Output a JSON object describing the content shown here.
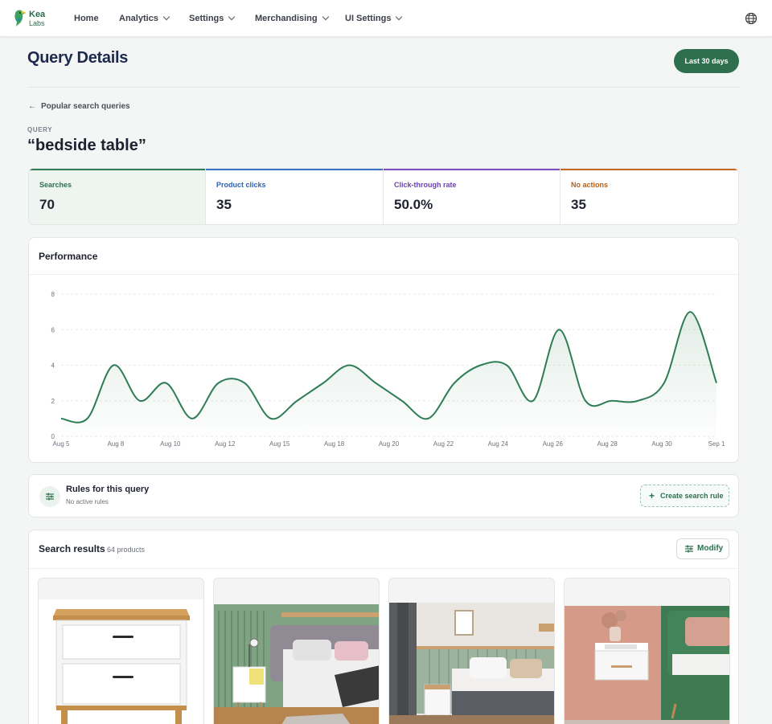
{
  "nav": {
    "brand_line1": "Kea",
    "brand_line2": "Labs",
    "items": [
      {
        "label": "Home",
        "has_menu": false
      },
      {
        "label": "Analytics",
        "has_menu": true
      },
      {
        "label": "Settings",
        "has_menu": true
      },
      {
        "label": "Merchandising",
        "has_menu": true
      },
      {
        "label": "UI Settings",
        "has_menu": true
      }
    ],
    "language_icon": "globe-icon"
  },
  "header": {
    "title": "Query Details",
    "date_range_label": "Last 30 days",
    "back_label": "Popular search queries"
  },
  "query": {
    "label": "QUERY",
    "text": "“bedside table”"
  },
  "stats": [
    {
      "label": "Searches",
      "value": "70",
      "color": "#2e7d55",
      "active": true
    },
    {
      "label": "Product clicks",
      "value": "35",
      "color": "#3a73c4",
      "active": false
    },
    {
      "label": "Click-through rate",
      "value": "50.0%",
      "color": "#7a4fc0",
      "active": false
    },
    {
      "label": "No actions",
      "value": "35",
      "color": "#c56a1d",
      "active": false
    }
  ],
  "performance": {
    "title": "Performance"
  },
  "chart_data": {
    "type": "area",
    "title": "Performance",
    "xlabel": "",
    "ylabel": "",
    "ylim": [
      0,
      8
    ],
    "yticks": [
      0,
      2,
      4,
      6,
      8
    ],
    "grid": true,
    "color": "#2e7d55",
    "x": [
      "Aug 5",
      "Aug 6",
      "Aug 7",
      "Aug 8",
      "Aug 9",
      "Aug 10",
      "Aug 11",
      "Aug 12",
      "Aug 13",
      "Aug 14",
      "Aug 15",
      "Aug 16",
      "Aug 17",
      "Aug 18",
      "Aug 19",
      "Aug 20",
      "Aug 21",
      "Aug 22",
      "Aug 23",
      "Aug 24",
      "Aug 25",
      "Aug 26",
      "Aug 27",
      "Aug 28",
      "Aug 29",
      "Aug 30",
      "Aug 31",
      "Sep 1"
    ],
    "x_tick_labels": [
      "Aug 5",
      "Aug 8",
      "Aug 10",
      "Aug 12",
      "Aug 15",
      "Aug 18",
      "Aug 20",
      "Aug 22",
      "Aug 24",
      "Aug 26",
      "Aug 28",
      "Aug 30",
      "Sep 1"
    ],
    "series": [
      {
        "values": [
          1,
          1,
          4,
          2,
          3,
          1,
          3,
          3,
          1,
          2,
          3,
          4,
          3,
          2,
          1,
          3,
          4,
          4,
          2,
          6,
          2,
          2,
          2,
          3,
          7,
          3
        ]
      }
    ]
  },
  "rules": {
    "title": "Rules for this query",
    "subtitle": "No active rules",
    "create_label": "Create search rule",
    "icon": "sliders-icon"
  },
  "results": {
    "title": "Search results",
    "count": "64 products",
    "modify_label": "Modify",
    "products": [
      {
        "image": "white-nightstand-wood-top"
      },
      {
        "image": "bedroom-green-wall-yellow-nightstand"
      },
      {
        "image": "bedroom-sage-wall-white-nightstand"
      },
      {
        "image": "floating-nightstand-pink-wall"
      }
    ]
  }
}
